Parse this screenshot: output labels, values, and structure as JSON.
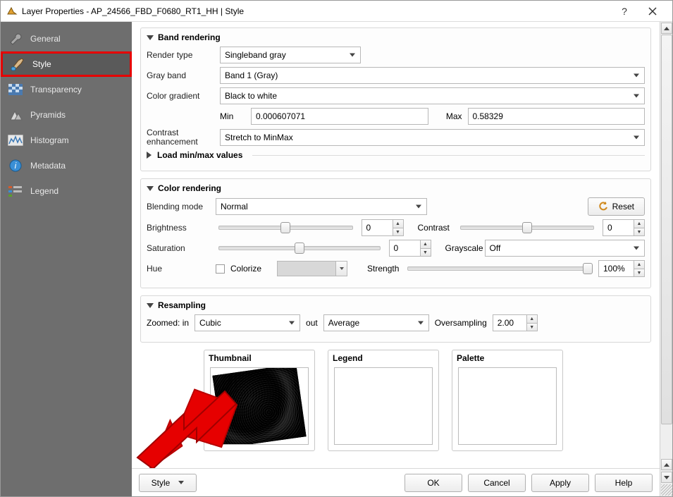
{
  "window": {
    "title": "Layer Properties - AP_24566_FBD_F0680_RT1_HH | Style"
  },
  "sidebar": {
    "items": [
      {
        "label": "General"
      },
      {
        "label": "Style"
      },
      {
        "label": "Transparency"
      },
      {
        "label": "Pyramids"
      },
      {
        "label": "Histogram"
      },
      {
        "label": "Metadata"
      },
      {
        "label": "Legend"
      }
    ],
    "selected_index": 1
  },
  "band_rendering": {
    "title": "Band rendering",
    "render_type_label": "Render type",
    "render_type_value": "Singleband gray",
    "gray_band_label": "Gray band",
    "gray_band_value": "Band 1 (Gray)",
    "color_gradient_label": "Color gradient",
    "color_gradient_value": "Black to white",
    "min_label": "Min",
    "min_value": "0.000607071",
    "max_label": "Max",
    "max_value": "0.58329",
    "contrast_label": "Contrast enhancement",
    "contrast_value": "Stretch to MinMax",
    "load_minmax_title": "Load min/max values"
  },
  "color_rendering": {
    "title": "Color rendering",
    "blending_label": "Blending mode",
    "blending_value": "Normal",
    "reset_label": "Reset",
    "brightness_label": "Brightness",
    "brightness_value": "0",
    "contrast_label": "Contrast",
    "contrast_value": "0",
    "saturation_label": "Saturation",
    "saturation_value": "0",
    "grayscale_label": "Grayscale",
    "grayscale_value": "Off",
    "hue_label": "Hue",
    "colorize_label": "Colorize",
    "strength_label": "Strength",
    "strength_value": "100%"
  },
  "resampling": {
    "title": "Resampling",
    "zoomed_in_label": "Zoomed: in",
    "zoomed_in_value": "Cubic",
    "out_label": "out",
    "out_value": "Average",
    "oversampling_label": "Oversampling",
    "oversampling_value": "2.00"
  },
  "previews": {
    "thumbnail_label": "Thumbnail",
    "legend_label": "Legend",
    "palette_label": "Palette"
  },
  "buttons": {
    "style": "Style",
    "ok": "OK",
    "cancel": "Cancel",
    "apply": "Apply",
    "help": "Help"
  }
}
